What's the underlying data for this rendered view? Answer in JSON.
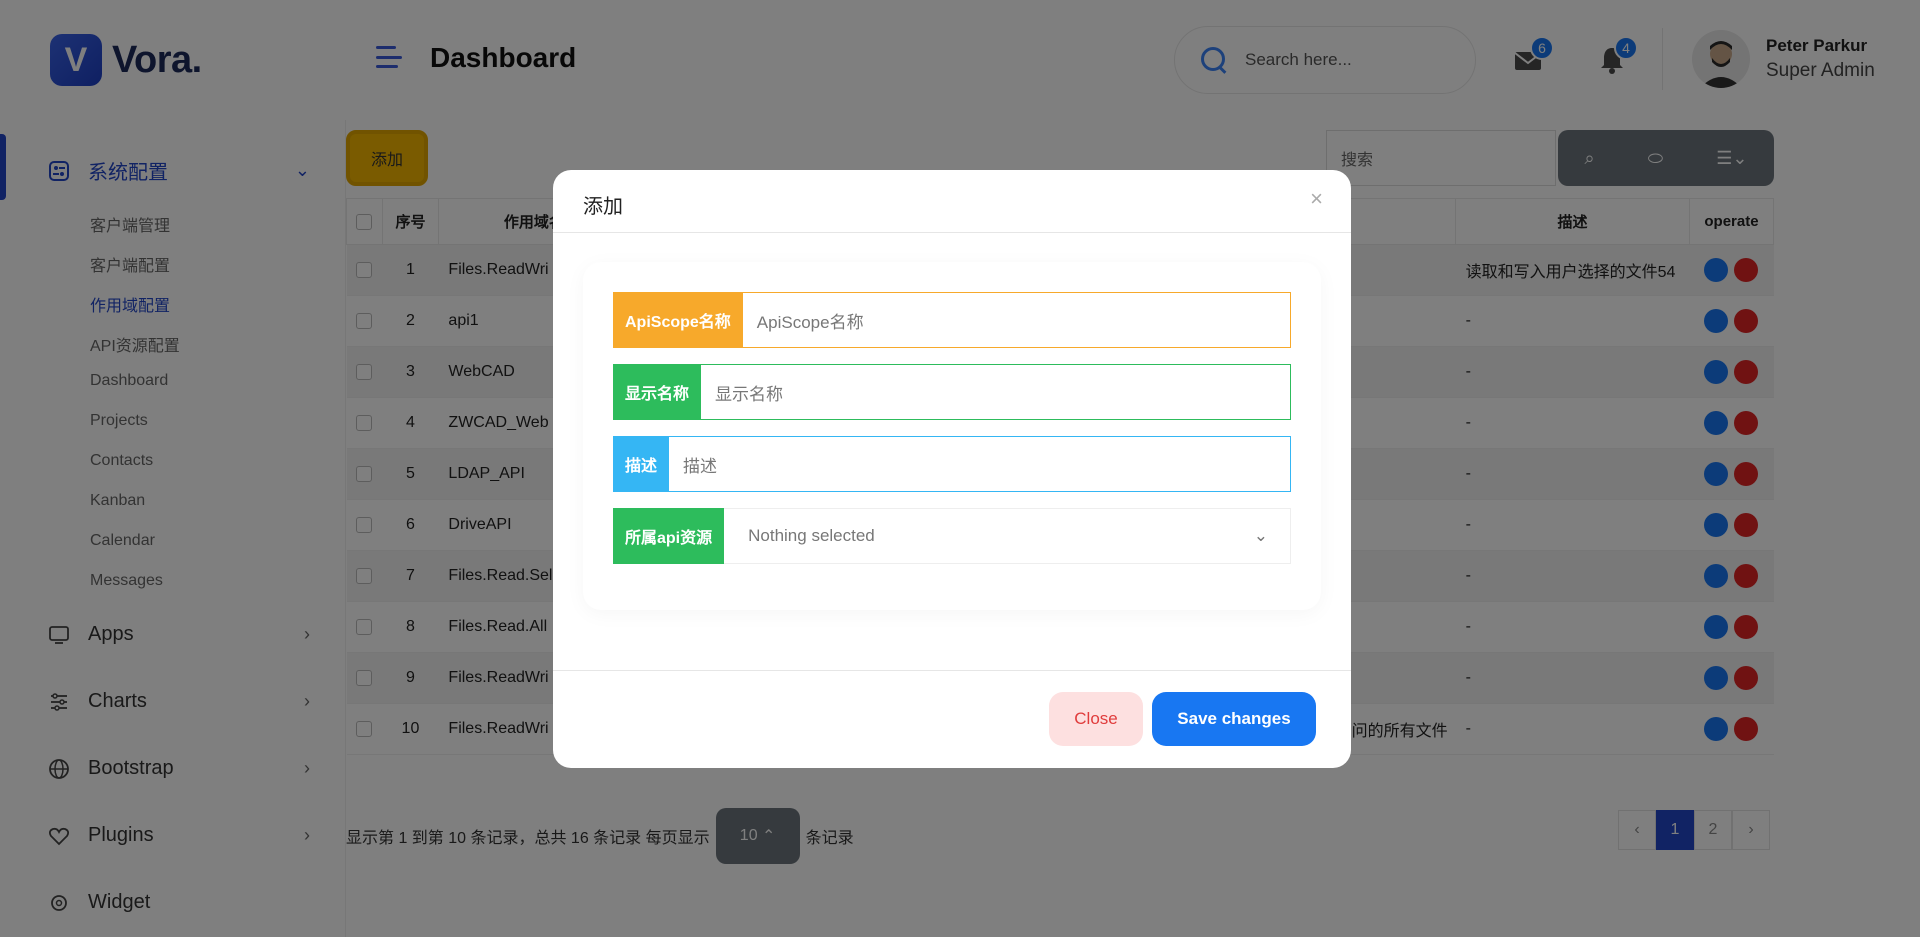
{
  "brand": {
    "letter": "V",
    "name": "Vora."
  },
  "header": {
    "title": "Dashboard",
    "search_placeholder": "Search here...",
    "mail_count": "6",
    "notification_count": "4",
    "user_name": "Peter Parkur",
    "user_role": "Super Admin"
  },
  "sidebar": {
    "groups": [
      {
        "label": "系统配置",
        "icon": "settings-grid-icon"
      },
      {
        "label": "Apps",
        "icon": "monitor-icon"
      },
      {
        "label": "Charts",
        "icon": "sliders-icon"
      },
      {
        "label": "Bootstrap",
        "icon": "globe-icon"
      },
      {
        "label": "Plugins",
        "icon": "heart-icon"
      },
      {
        "label": "Widget",
        "icon": "gear-icon"
      }
    ],
    "sub_items": [
      "客户端管理",
      "客户端配置",
      "作用域配置",
      "API资源配置",
      "Dashboard",
      "Projects",
      "Contacts",
      "Kanban",
      "Calendar",
      "Messages"
    ],
    "active_sub": "作用域配置"
  },
  "toolbar": {
    "add_label": "添加",
    "search_placeholder": "搜索"
  },
  "table": {
    "headers": [
      "序号",
      "作用域名称",
      "描述",
      "operate"
    ],
    "rows": [
      {
        "n": "1",
        "name": "Files.ReadWri",
        "desc": "读取和写入用户选择的文件54"
      },
      {
        "n": "2",
        "name": "api1",
        "desc": "-"
      },
      {
        "n": "3",
        "name": "WebCAD",
        "desc": "-"
      },
      {
        "n": "4",
        "name": "ZWCAD_Web",
        "desc": "-"
      },
      {
        "n": "5",
        "name": "LDAP_API",
        "desc": "-"
      },
      {
        "n": "6",
        "name": "DriveAPI",
        "desc": "-"
      },
      {
        "n": "7",
        "name": "Files.Read.Sel",
        "desc": "-"
      },
      {
        "n": "8",
        "name": "Files.Read.All",
        "desc": "-"
      },
      {
        "n": "9",
        "name": "Files.ReadWri",
        "desc": "-"
      },
      {
        "n": "10",
        "name": "Files.ReadWri",
        "display_tail": "问的所有文件",
        "desc": "-"
      }
    ]
  },
  "pagination": {
    "info_prefix": "显示第 1 到第 10 条记录，总共 16 条记录  每页显示",
    "page_size": "10",
    "info_suffix": "条记录",
    "pages": [
      "1",
      "2"
    ],
    "current": "1",
    "prev": "‹",
    "next": "›"
  },
  "modal": {
    "title": "添加",
    "close_x": "×",
    "fields": [
      {
        "label": "ApiScope名称",
        "placeholder": "ApiScope名称",
        "color": "#f7a92b"
      },
      {
        "label": "显示名称",
        "placeholder": "显示名称",
        "color": "#2dbc5c"
      },
      {
        "label": "描述",
        "placeholder": "描述",
        "color": "#35b6f4"
      },
      {
        "label": "所属api资源",
        "value": "Nothing selected",
        "color": "#2dbc5c"
      }
    ],
    "close_label": "Close",
    "save_label": "Save changes"
  }
}
